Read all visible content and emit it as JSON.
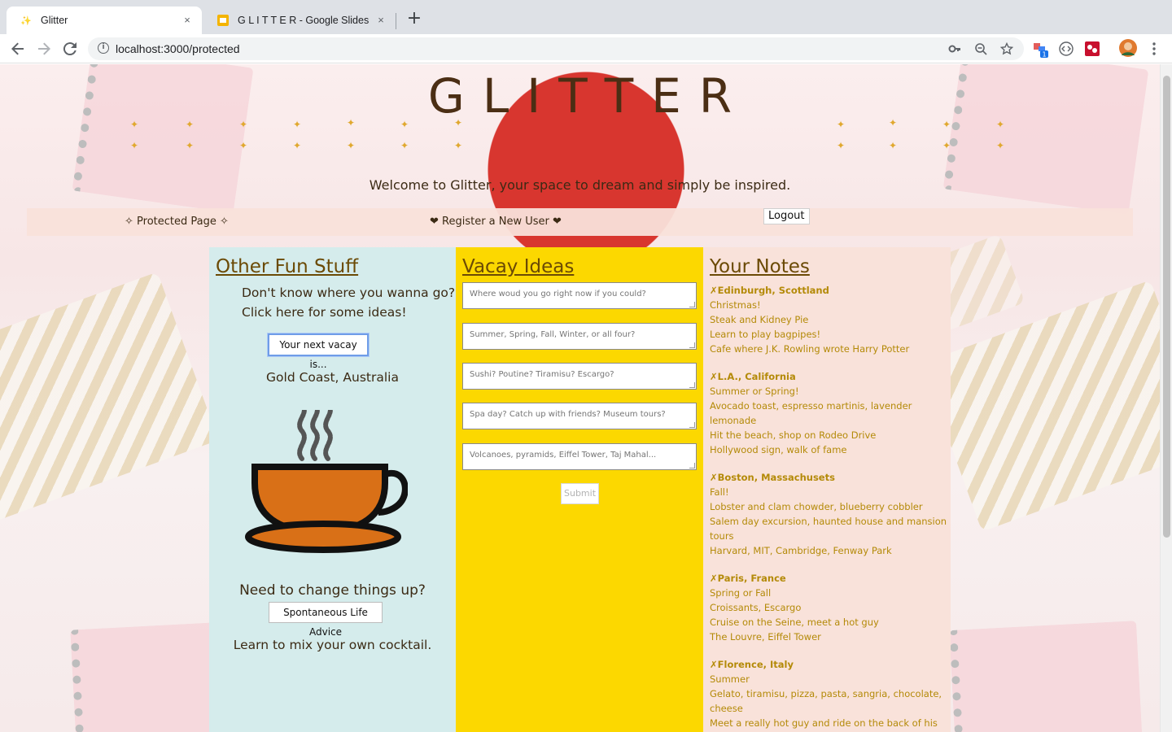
{
  "browser": {
    "tabs": [
      {
        "title": "Glitter",
        "favicon": "sparkle-icon",
        "active": true
      },
      {
        "title": "G L I T T E R - Google Slides",
        "favicon": "slides-icon",
        "active": false
      }
    ],
    "close_glyph": "×",
    "new_tab_glyph": "+",
    "url": "localhost:3000/protected"
  },
  "header": {
    "logo": "GLITTER",
    "welcome": "Welcome to Glitter, your space to dream and simply be inspired."
  },
  "nav": {
    "protected": "✧ Protected Page ✧",
    "register": "❤ Register a New User ❤",
    "logout": "Logout"
  },
  "fun": {
    "title": "Other Fun Stuff",
    "prompt_line1": "Don't know where you wanna go?",
    "prompt_line2": "Click here for some ideas!",
    "vacay_button": "Your next vacay is...",
    "vacay_result": "Gold Coast, Australia",
    "change_prompt": "Need to change things up?",
    "advice_button": "Spontaneous Life Advice",
    "cocktail": "Learn to mix your own cocktail."
  },
  "vacay": {
    "title": "Vacay Ideas",
    "fields": [
      "Where woud you go right now if you could?",
      "Summer, Spring, Fall, Winter, or all four?",
      "Sushi? Poutine? Tiramisu? Escargo?",
      "Spa day? Catch up with friends? Museum tours?",
      "Volcanoes, pyramids, Eiffel Tower, Taj Mahal..."
    ],
    "submit": "Submit"
  },
  "notes": {
    "title": "Your Notes",
    "delete_glyph": "✗",
    "items": [
      {
        "place": "Edinburgh, Scottland",
        "season": "Christmas!",
        "food": "Steak and Kidney Pie",
        "activity": "Learn to play bagpipes!",
        "sights": "Cafe where J.K. Rowling wrote Harry Potter"
      },
      {
        "place": "L.A., California",
        "season": "Summer or Spring!",
        "food": "Avocado toast, espresso martinis, lavender lemonade",
        "activity": "Hit the beach, shop on Rodeo Drive",
        "sights": "Hollywood sign, walk of fame"
      },
      {
        "place": "Boston, Massachusets",
        "season": "Fall!",
        "food": "Lobster and clam chowder, blueberry cobbler",
        "activity": "Salem day excursion, haunted house and mansion tours",
        "sights": "Harvard, MIT, Cambridge, Fenway Park"
      },
      {
        "place": "Paris, France",
        "season": "Spring or Fall",
        "food": "Croissants, Escargo",
        "activity": "Cruise on the Seine, meet a hot guy",
        "sights": "The Louvre, Eiffel Tower"
      },
      {
        "place": "Florence, Italy",
        "season": "Summer",
        "food": "Gelato, tiramisu, pizza, pasta, sangria, chocolate, cheese",
        "activity": "Meet a really hot guy and ride on the back of his motorcycle",
        "sights": ""
      }
    ]
  },
  "colors": {
    "fun_column": "#d5ecec",
    "vacay_column": "#fcd800",
    "notes_column": "#f9e2da",
    "notes_text": "#b48a08",
    "heading": "#6b4a05",
    "teacup_fill": "#d97017"
  }
}
